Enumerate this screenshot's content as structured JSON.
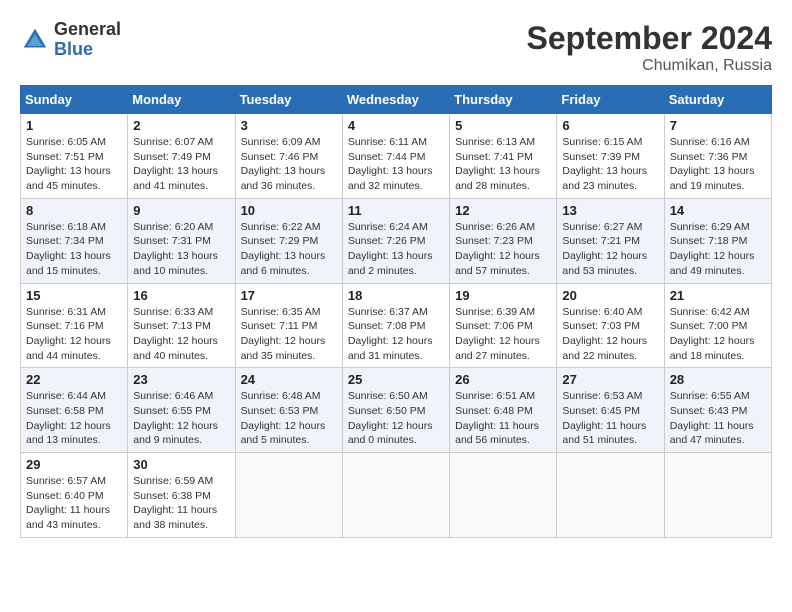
{
  "header": {
    "logo_general": "General",
    "logo_blue": "Blue",
    "month_title": "September 2024",
    "location": "Chumikan, Russia"
  },
  "columns": [
    "Sunday",
    "Monday",
    "Tuesday",
    "Wednesday",
    "Thursday",
    "Friday",
    "Saturday"
  ],
  "weeks": [
    [
      {
        "day": "1",
        "sunrise": "Sunrise: 6:05 AM",
        "sunset": "Sunset: 7:51 PM",
        "daylight": "Daylight: 13 hours and 45 minutes."
      },
      {
        "day": "2",
        "sunrise": "Sunrise: 6:07 AM",
        "sunset": "Sunset: 7:49 PM",
        "daylight": "Daylight: 13 hours and 41 minutes."
      },
      {
        "day": "3",
        "sunrise": "Sunrise: 6:09 AM",
        "sunset": "Sunset: 7:46 PM",
        "daylight": "Daylight: 13 hours and 36 minutes."
      },
      {
        "day": "4",
        "sunrise": "Sunrise: 6:11 AM",
        "sunset": "Sunset: 7:44 PM",
        "daylight": "Daylight: 13 hours and 32 minutes."
      },
      {
        "day": "5",
        "sunrise": "Sunrise: 6:13 AM",
        "sunset": "Sunset: 7:41 PM",
        "daylight": "Daylight: 13 hours and 28 minutes."
      },
      {
        "day": "6",
        "sunrise": "Sunrise: 6:15 AM",
        "sunset": "Sunset: 7:39 PM",
        "daylight": "Daylight: 13 hours and 23 minutes."
      },
      {
        "day": "7",
        "sunrise": "Sunrise: 6:16 AM",
        "sunset": "Sunset: 7:36 PM",
        "daylight": "Daylight: 13 hours and 19 minutes."
      }
    ],
    [
      {
        "day": "8",
        "sunrise": "Sunrise: 6:18 AM",
        "sunset": "Sunset: 7:34 PM",
        "daylight": "Daylight: 13 hours and 15 minutes."
      },
      {
        "day": "9",
        "sunrise": "Sunrise: 6:20 AM",
        "sunset": "Sunset: 7:31 PM",
        "daylight": "Daylight: 13 hours and 10 minutes."
      },
      {
        "day": "10",
        "sunrise": "Sunrise: 6:22 AM",
        "sunset": "Sunset: 7:29 PM",
        "daylight": "Daylight: 13 hours and 6 minutes."
      },
      {
        "day": "11",
        "sunrise": "Sunrise: 6:24 AM",
        "sunset": "Sunset: 7:26 PM",
        "daylight": "Daylight: 13 hours and 2 minutes."
      },
      {
        "day": "12",
        "sunrise": "Sunrise: 6:26 AM",
        "sunset": "Sunset: 7:23 PM",
        "daylight": "Daylight: 12 hours and 57 minutes."
      },
      {
        "day": "13",
        "sunrise": "Sunrise: 6:27 AM",
        "sunset": "Sunset: 7:21 PM",
        "daylight": "Daylight: 12 hours and 53 minutes."
      },
      {
        "day": "14",
        "sunrise": "Sunrise: 6:29 AM",
        "sunset": "Sunset: 7:18 PM",
        "daylight": "Daylight: 12 hours and 49 minutes."
      }
    ],
    [
      {
        "day": "15",
        "sunrise": "Sunrise: 6:31 AM",
        "sunset": "Sunset: 7:16 PM",
        "daylight": "Daylight: 12 hours and 44 minutes."
      },
      {
        "day": "16",
        "sunrise": "Sunrise: 6:33 AM",
        "sunset": "Sunset: 7:13 PM",
        "daylight": "Daylight: 12 hours and 40 minutes."
      },
      {
        "day": "17",
        "sunrise": "Sunrise: 6:35 AM",
        "sunset": "Sunset: 7:11 PM",
        "daylight": "Daylight: 12 hours and 35 minutes."
      },
      {
        "day": "18",
        "sunrise": "Sunrise: 6:37 AM",
        "sunset": "Sunset: 7:08 PM",
        "daylight": "Daylight: 12 hours and 31 minutes."
      },
      {
        "day": "19",
        "sunrise": "Sunrise: 6:39 AM",
        "sunset": "Sunset: 7:06 PM",
        "daylight": "Daylight: 12 hours and 27 minutes."
      },
      {
        "day": "20",
        "sunrise": "Sunrise: 6:40 AM",
        "sunset": "Sunset: 7:03 PM",
        "daylight": "Daylight: 12 hours and 22 minutes."
      },
      {
        "day": "21",
        "sunrise": "Sunrise: 6:42 AM",
        "sunset": "Sunset: 7:00 PM",
        "daylight": "Daylight: 12 hours and 18 minutes."
      }
    ],
    [
      {
        "day": "22",
        "sunrise": "Sunrise: 6:44 AM",
        "sunset": "Sunset: 6:58 PM",
        "daylight": "Daylight: 12 hours and 13 minutes."
      },
      {
        "day": "23",
        "sunrise": "Sunrise: 6:46 AM",
        "sunset": "Sunset: 6:55 PM",
        "daylight": "Daylight: 12 hours and 9 minutes."
      },
      {
        "day": "24",
        "sunrise": "Sunrise: 6:48 AM",
        "sunset": "Sunset: 6:53 PM",
        "daylight": "Daylight: 12 hours and 5 minutes."
      },
      {
        "day": "25",
        "sunrise": "Sunrise: 6:50 AM",
        "sunset": "Sunset: 6:50 PM",
        "daylight": "Daylight: 12 hours and 0 minutes."
      },
      {
        "day": "26",
        "sunrise": "Sunrise: 6:51 AM",
        "sunset": "Sunset: 6:48 PM",
        "daylight": "Daylight: 11 hours and 56 minutes."
      },
      {
        "day": "27",
        "sunrise": "Sunrise: 6:53 AM",
        "sunset": "Sunset: 6:45 PM",
        "daylight": "Daylight: 11 hours and 51 minutes."
      },
      {
        "day": "28",
        "sunrise": "Sunrise: 6:55 AM",
        "sunset": "Sunset: 6:43 PM",
        "daylight": "Daylight: 11 hours and 47 minutes."
      }
    ],
    [
      {
        "day": "29",
        "sunrise": "Sunrise: 6:57 AM",
        "sunset": "Sunset: 6:40 PM",
        "daylight": "Daylight: 11 hours and 43 minutes."
      },
      {
        "day": "30",
        "sunrise": "Sunrise: 6:59 AM",
        "sunset": "Sunset: 6:38 PM",
        "daylight": "Daylight: 11 hours and 38 minutes."
      },
      null,
      null,
      null,
      null,
      null
    ]
  ]
}
